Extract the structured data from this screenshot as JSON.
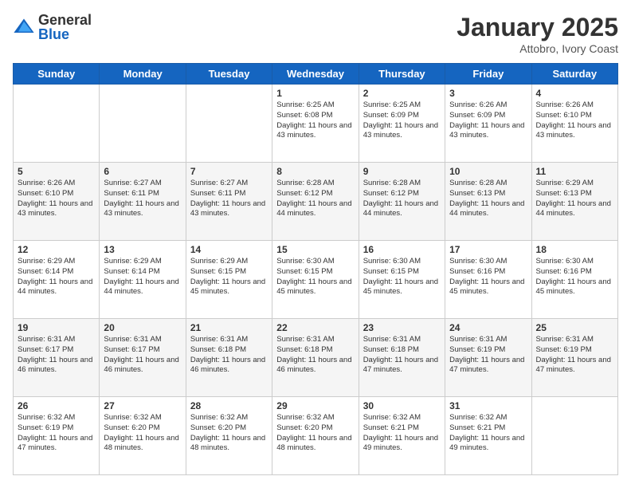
{
  "header": {
    "logo_general": "General",
    "logo_blue": "Blue",
    "month_title": "January 2025",
    "subtitle": "Attobro, Ivory Coast"
  },
  "days_of_week": [
    "Sunday",
    "Monday",
    "Tuesday",
    "Wednesday",
    "Thursday",
    "Friday",
    "Saturday"
  ],
  "weeks": [
    [
      {
        "day": "",
        "info": ""
      },
      {
        "day": "",
        "info": ""
      },
      {
        "day": "",
        "info": ""
      },
      {
        "day": "1",
        "info": "Sunrise: 6:25 AM\nSunset: 6:08 PM\nDaylight: 11 hours and 43 minutes."
      },
      {
        "day": "2",
        "info": "Sunrise: 6:25 AM\nSunset: 6:09 PM\nDaylight: 11 hours and 43 minutes."
      },
      {
        "day": "3",
        "info": "Sunrise: 6:26 AM\nSunset: 6:09 PM\nDaylight: 11 hours and 43 minutes."
      },
      {
        "day": "4",
        "info": "Sunrise: 6:26 AM\nSunset: 6:10 PM\nDaylight: 11 hours and 43 minutes."
      }
    ],
    [
      {
        "day": "5",
        "info": "Sunrise: 6:26 AM\nSunset: 6:10 PM\nDaylight: 11 hours and 43 minutes."
      },
      {
        "day": "6",
        "info": "Sunrise: 6:27 AM\nSunset: 6:11 PM\nDaylight: 11 hours and 43 minutes."
      },
      {
        "day": "7",
        "info": "Sunrise: 6:27 AM\nSunset: 6:11 PM\nDaylight: 11 hours and 43 minutes."
      },
      {
        "day": "8",
        "info": "Sunrise: 6:28 AM\nSunset: 6:12 PM\nDaylight: 11 hours and 44 minutes."
      },
      {
        "day": "9",
        "info": "Sunrise: 6:28 AM\nSunset: 6:12 PM\nDaylight: 11 hours and 44 minutes."
      },
      {
        "day": "10",
        "info": "Sunrise: 6:28 AM\nSunset: 6:13 PM\nDaylight: 11 hours and 44 minutes."
      },
      {
        "day": "11",
        "info": "Sunrise: 6:29 AM\nSunset: 6:13 PM\nDaylight: 11 hours and 44 minutes."
      }
    ],
    [
      {
        "day": "12",
        "info": "Sunrise: 6:29 AM\nSunset: 6:14 PM\nDaylight: 11 hours and 44 minutes."
      },
      {
        "day": "13",
        "info": "Sunrise: 6:29 AM\nSunset: 6:14 PM\nDaylight: 11 hours and 44 minutes."
      },
      {
        "day": "14",
        "info": "Sunrise: 6:29 AM\nSunset: 6:15 PM\nDaylight: 11 hours and 45 minutes."
      },
      {
        "day": "15",
        "info": "Sunrise: 6:30 AM\nSunset: 6:15 PM\nDaylight: 11 hours and 45 minutes."
      },
      {
        "day": "16",
        "info": "Sunrise: 6:30 AM\nSunset: 6:15 PM\nDaylight: 11 hours and 45 minutes."
      },
      {
        "day": "17",
        "info": "Sunrise: 6:30 AM\nSunset: 6:16 PM\nDaylight: 11 hours and 45 minutes."
      },
      {
        "day": "18",
        "info": "Sunrise: 6:30 AM\nSunset: 6:16 PM\nDaylight: 11 hours and 45 minutes."
      }
    ],
    [
      {
        "day": "19",
        "info": "Sunrise: 6:31 AM\nSunset: 6:17 PM\nDaylight: 11 hours and 46 minutes."
      },
      {
        "day": "20",
        "info": "Sunrise: 6:31 AM\nSunset: 6:17 PM\nDaylight: 11 hours and 46 minutes."
      },
      {
        "day": "21",
        "info": "Sunrise: 6:31 AM\nSunset: 6:18 PM\nDaylight: 11 hours and 46 minutes."
      },
      {
        "day": "22",
        "info": "Sunrise: 6:31 AM\nSunset: 6:18 PM\nDaylight: 11 hours and 46 minutes."
      },
      {
        "day": "23",
        "info": "Sunrise: 6:31 AM\nSunset: 6:18 PM\nDaylight: 11 hours and 47 minutes."
      },
      {
        "day": "24",
        "info": "Sunrise: 6:31 AM\nSunset: 6:19 PM\nDaylight: 11 hours and 47 minutes."
      },
      {
        "day": "25",
        "info": "Sunrise: 6:31 AM\nSunset: 6:19 PM\nDaylight: 11 hours and 47 minutes."
      }
    ],
    [
      {
        "day": "26",
        "info": "Sunrise: 6:32 AM\nSunset: 6:19 PM\nDaylight: 11 hours and 47 minutes."
      },
      {
        "day": "27",
        "info": "Sunrise: 6:32 AM\nSunset: 6:20 PM\nDaylight: 11 hours and 48 minutes."
      },
      {
        "day": "28",
        "info": "Sunrise: 6:32 AM\nSunset: 6:20 PM\nDaylight: 11 hours and 48 minutes."
      },
      {
        "day": "29",
        "info": "Sunrise: 6:32 AM\nSunset: 6:20 PM\nDaylight: 11 hours and 48 minutes."
      },
      {
        "day": "30",
        "info": "Sunrise: 6:32 AM\nSunset: 6:21 PM\nDaylight: 11 hours and 49 minutes."
      },
      {
        "day": "31",
        "info": "Sunrise: 6:32 AM\nSunset: 6:21 PM\nDaylight: 11 hours and 49 minutes."
      },
      {
        "day": "",
        "info": ""
      }
    ]
  ]
}
